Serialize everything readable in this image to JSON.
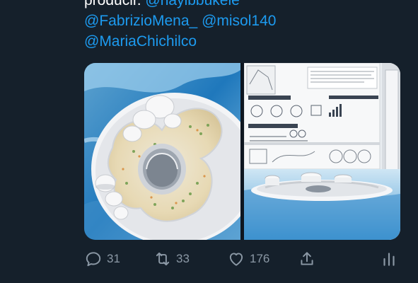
{
  "tweet": {
    "line1_prefix": "producir. ",
    "line1_mention": "@nayibbukele",
    "line2_mention_a": "@FabrizioMena_",
    "line2_mention_b": "@misol140",
    "line3_mention": "@MariaChichilco"
  },
  "media": {
    "left_alt": "Architectural model of a circular garden platform",
    "right_alt": "Exhibition board with urban context and platform model"
  },
  "actions": {
    "reply_count": "31",
    "retweet_count": "33",
    "like_count": "176",
    "share_icon": "share-icon",
    "analytics_icon": "analytics-icon"
  },
  "colors": {
    "background": "#15202b",
    "accent": "#1d9bf0",
    "muted": "#8b98a5",
    "text": "#ffffff"
  }
}
